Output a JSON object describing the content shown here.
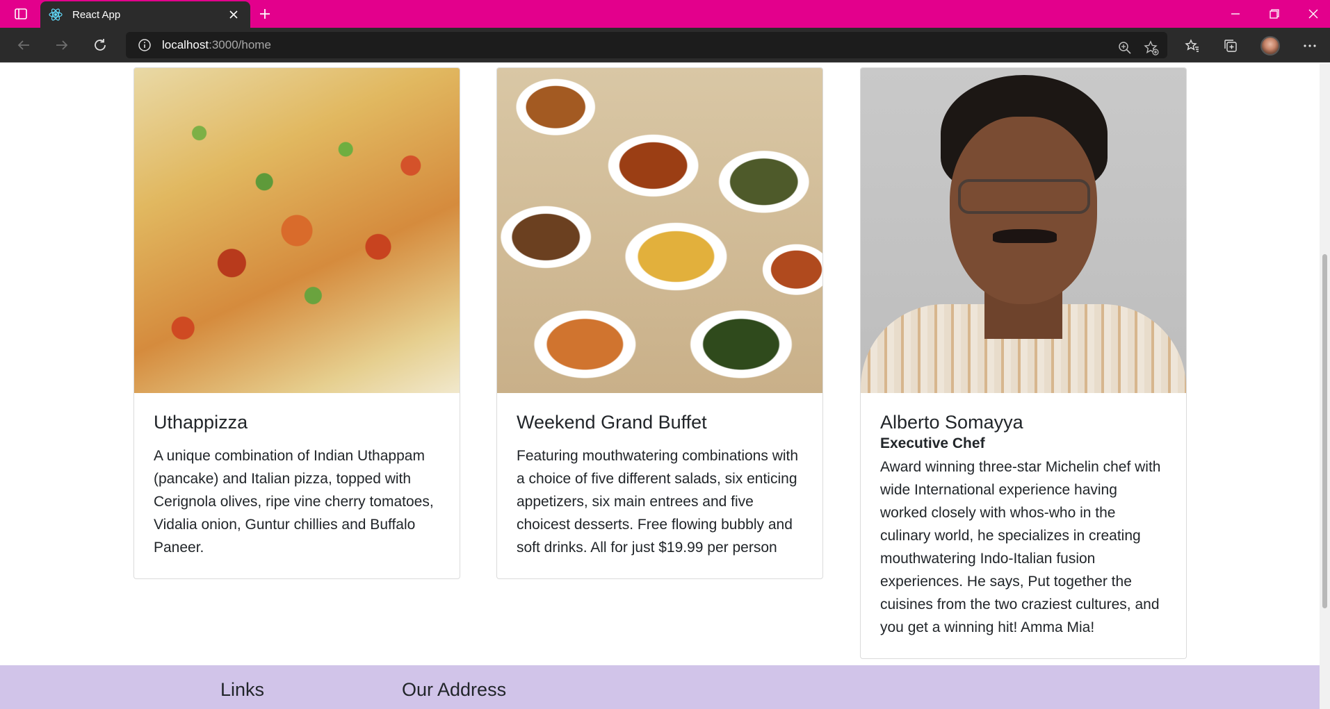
{
  "browser": {
    "tab_title": "React App",
    "url_host": "localhost",
    "url_path": ":3000/home",
    "theme_color": "#e3008c"
  },
  "cards": [
    {
      "image": "pizza-photo",
      "title": "Uthappizza",
      "subtitle": "",
      "text": "A unique combination of Indian Uthappam (pancake) and Italian pizza, topped with Cerignola olives, ripe vine cherry tomatoes, Vidalia onion, Guntur chillies and Buffalo Paneer."
    },
    {
      "image": "buffet-photo",
      "title": "Weekend Grand Buffet",
      "subtitle": "",
      "text": "Featuring mouthwatering combinations with a choice of five different salads, six enticing appetizers, six main entrees and five choicest desserts. Free flowing bubbly and soft drinks. All for just $19.99 per person"
    },
    {
      "image": "chef-photo",
      "title": "Alberto Somayya",
      "subtitle": "Executive Chef",
      "text": "Award winning three-star Michelin chef with wide International experience having worked closely with whos-who in the culinary world, he specializes in creating mouthwatering Indo-Italian fusion experiences. He says, Put together the cuisines from the two craziest cultures, and you get a winning hit! Amma Mia!"
    }
  ],
  "footer": {
    "links_heading": "Links",
    "address_heading": "Our Address",
    "background": "#d1c4e9"
  }
}
